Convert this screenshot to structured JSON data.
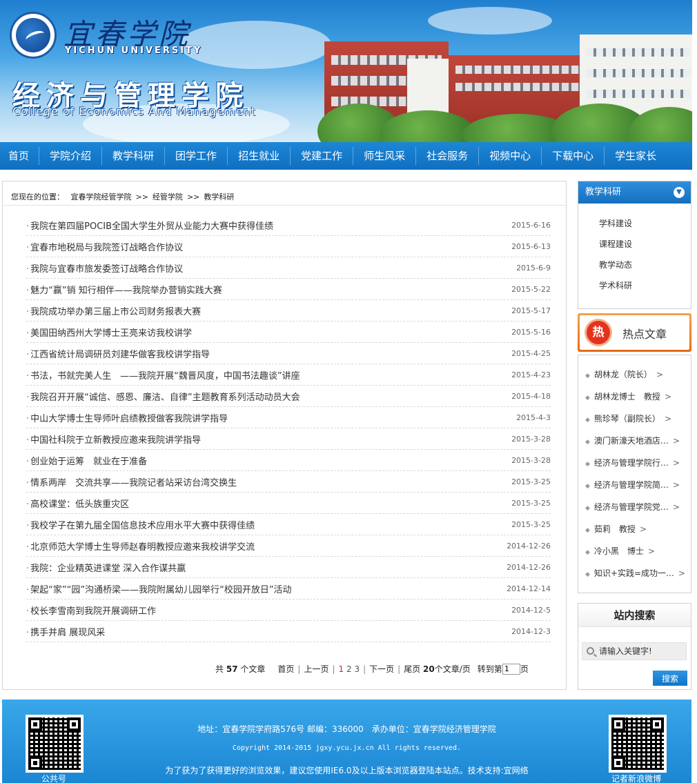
{
  "header": {
    "university_cn": "宜春学院",
    "university_en": "YICHUN UNIVERSITY",
    "college_cn": "经济与管理学院",
    "college_en": "College of Economics And Management"
  },
  "nav": {
    "items": [
      "首页",
      "学院介绍",
      "教学科研",
      "团学工作",
      "招生就业",
      "党建工作",
      "师生风采",
      "社会服务",
      "视频中心",
      "下载中心",
      "学生家长"
    ]
  },
  "breadcrumb": {
    "label": "您现在的位置：",
    "crumbs": [
      "宜春学院经管学院",
      "经管学院",
      "教学科研"
    ],
    "separator": ">>"
  },
  "articles": [
    {
      "title": "我院在第四届POCIB全国大学生外贸从业能力大赛中获得佳绩",
      "date": "2015-6-16"
    },
    {
      "title": "宜春市地税局与我院签订战略合作协议",
      "date": "2015-6-13"
    },
    {
      "title": "我院与宜春市旅发委签订战略合作协议",
      "date": "2015-6-9"
    },
    {
      "title": "魅力“赢”销 知行相伴——我院举办营销实践大赛",
      "date": "2015-5-22"
    },
    {
      "title": "我院成功举办第三届上市公司财务报表大赛",
      "date": "2015-5-17"
    },
    {
      "title": "美国田纳西州大学博士王亮来访我校讲学",
      "date": "2015-5-16"
    },
    {
      "title": "江西省统计局调研员刘建华做客我校讲学指导",
      "date": "2015-4-25"
    },
    {
      "title": "书法，书就完美人生　——我院开展“魏晋风度，中国书法趣谈”讲座",
      "date": "2015-4-23"
    },
    {
      "title": "我院召开开展“诚信、感恩、廉洁、自律”主题教育系列活动动员大会",
      "date": "2015-4-18"
    },
    {
      "title": "中山大学博士生导师叶启绩教授做客我院讲学指导",
      "date": "2015-4-3"
    },
    {
      "title": "中国社科院于立新教授应邀来我院讲学指导",
      "date": "2015-3-28"
    },
    {
      "title": "创业始于运筹　就业在于准备",
      "date": "2015-3-28"
    },
    {
      "title": "情系两岸　交流共享——我院记者站采访台湾交换生",
      "date": "2015-3-25"
    },
    {
      "title": "高校课堂：低头族重灾区",
      "date": "2015-3-25"
    },
    {
      "title": "我校学子在第九届全国信息技术应用水平大赛中获得佳绩",
      "date": "2015-3-25"
    },
    {
      "title": "北京师范大学博士生导师赵春明教授应邀来我校讲学交流",
      "date": "2014-12-26"
    },
    {
      "title": "我院：企业精英进课堂 深入合作谋共赢",
      "date": "2014-12-26"
    },
    {
      "title": "架起“家”“园”沟通桥梁——我院附属幼儿园举行“校园开放日”活动",
      "date": "2014-12-14"
    },
    {
      "title": "校长李雪南到我院开展调研工作",
      "date": "2014-12-5"
    },
    {
      "title": "携手并肩 展现风采",
      "date": "2014-12-3"
    }
  ],
  "pager": {
    "total_prefix": "共",
    "total": "57",
    "total_suffix": "个文章",
    "first": "首页",
    "prev": "上一页",
    "pages": [
      "1",
      "2",
      "3"
    ],
    "current_page": "1",
    "next": "下一页",
    "last": "尾页",
    "per_page": "20",
    "per_page_suffix": "个文章/页",
    "goto_prefix": "转到第",
    "goto_value": "1",
    "goto_suffix": "页"
  },
  "sidebar": {
    "category_title": "教学科研",
    "categories": [
      "学科建设",
      "课程建设",
      "教学动态",
      "学术科研"
    ],
    "hot_badge": "热",
    "hot_title": "热点文章",
    "hot_items": [
      "胡林龙（院长）",
      "胡林龙博士　教授",
      "熊珍琴（副院长）",
      "澳门新濠天地酒店…",
      "经济与管理学院行…",
      "经济与管理学院简…",
      "经济与管理学院党…",
      "茹莉　教授",
      "冷小黑　博士",
      "知识+实践=成功一…"
    ],
    "hot_bullet": "◆",
    "hot_arrow": ">",
    "search_title": "站内搜索",
    "search_placeholder": "请输入关键字!",
    "search_button": "搜索"
  },
  "footer": {
    "address": "地址：宜春学院学府路576号 邮编：336000　承办单位：宜春学院经济管理学院",
    "copyright": "Copyright 2014-2015 jgxy.ycu.jx.cn All rights reserved.",
    "support": "为了获为了获得更好的浏览效果，建议您使用IE6.0及以上版本浏览器登陆本站点。技术支持:宜网络",
    "qr_left_label": "公共号",
    "qr_right_label": "记者新浪微博"
  },
  "colors": {
    "nav_bg": "#1277c8",
    "accent_blue": "#1570c0",
    "hot_orange": "#e56a12",
    "current_page_red": "#e02020"
  }
}
